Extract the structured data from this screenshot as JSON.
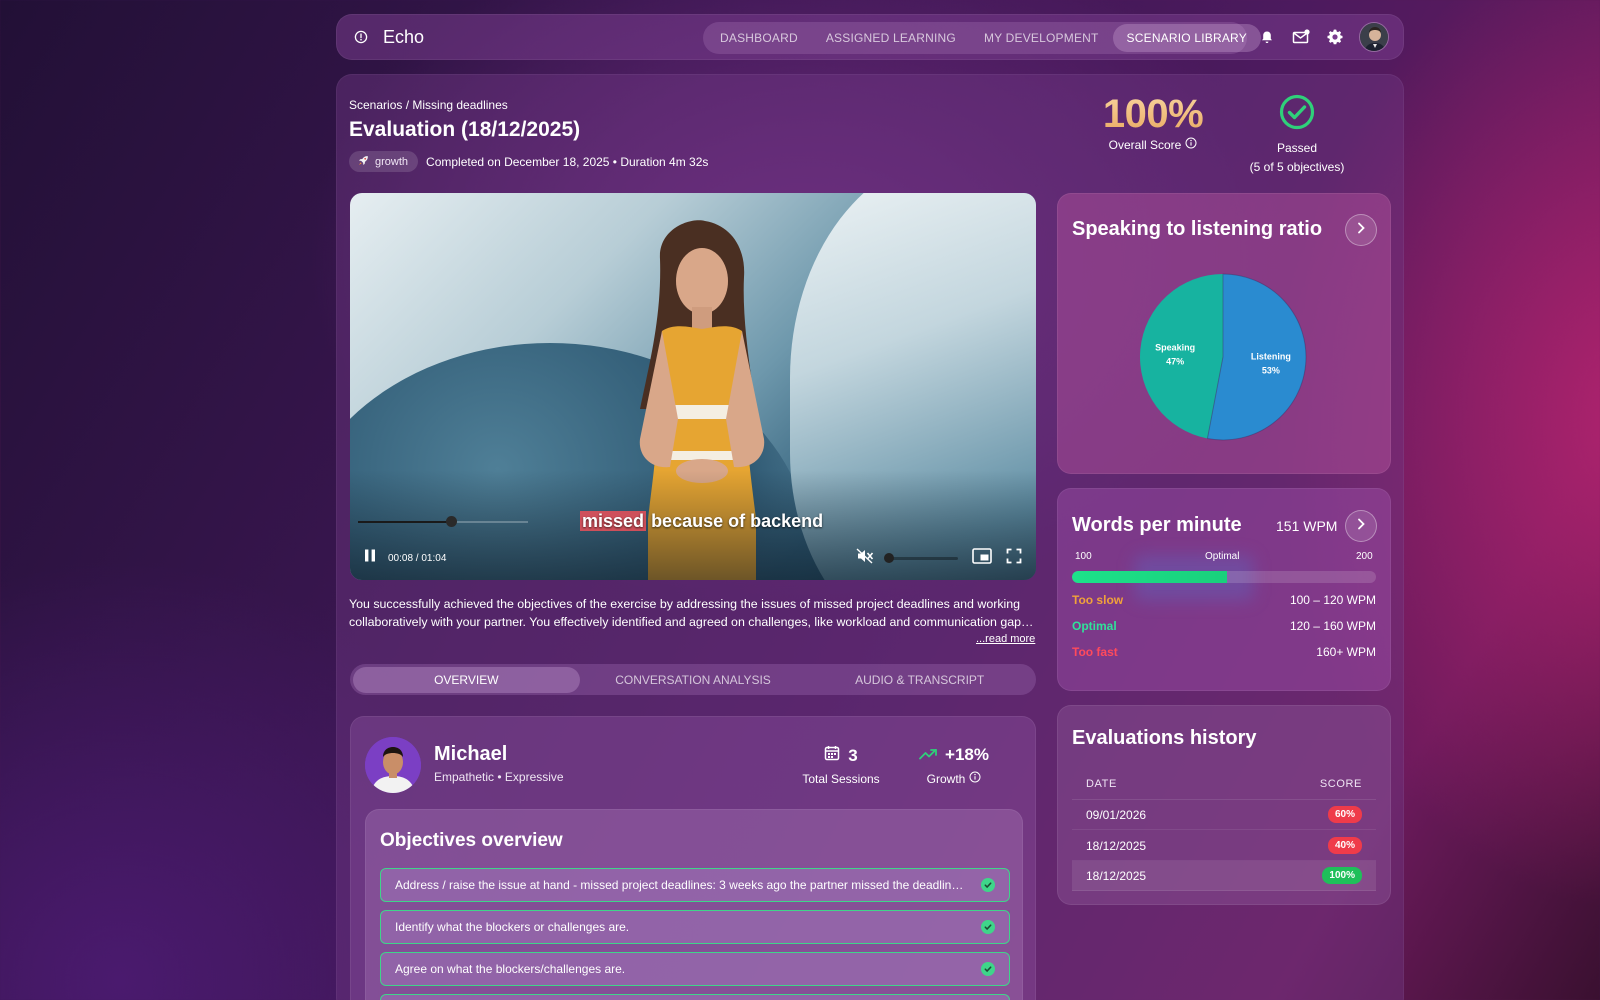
{
  "app": {
    "name": "Echo"
  },
  "nav": {
    "tabs": [
      {
        "label": "DASHBOARD"
      },
      {
        "label": "ASSIGNED LEARNING"
      },
      {
        "label": "MY DEVELOPMENT"
      },
      {
        "label": "SCENARIO LIBRARY",
        "active": true
      }
    ],
    "icons": [
      "bell-icon",
      "mail-icon",
      "gear-icon",
      "avatar"
    ]
  },
  "header": {
    "breadcrumb": "Scenarios / Missing deadlines",
    "title": "Evaluation (18/12/2025)",
    "tag": "growth",
    "completed": "Completed on December 18, 2025 • Duration 4m 32s"
  },
  "score": {
    "value": "100%",
    "label": "Overall Score",
    "status": "Passed",
    "objectives": "(5 of 5 objectives)"
  },
  "video": {
    "caption_highlight": "missed",
    "caption_rest": "because of backend",
    "time": "00:08 / 01:04",
    "progress": 0.135
  },
  "summary": {
    "text": "You successfully achieved the objectives of the exercise by addressing the issues of missed project deadlines and working collaboratively with your partner. You effectively identified and agreed on challenges, like workload and communication gap…",
    "read_more": "...read more"
  },
  "tabs": [
    {
      "label": "OVERVIEW",
      "active": true
    },
    {
      "label": "CONVERSATION ANALYSIS"
    },
    {
      "label": "AUDIO & TRANSCRIPT"
    }
  ],
  "persona": {
    "name": "Michael",
    "traits": "Empathetic • Expressive",
    "sessions_value": "3",
    "sessions_label": "Total Sessions",
    "growth_value": "+18%",
    "growth_label": "Growth"
  },
  "objectives": {
    "title": "Objectives overview",
    "items": [
      "Address / raise the issue at hand - missed project deadlines: 3 weeks ago the partner missed the deadline for the project deliverable",
      "Identify what the blockers or challenges are.",
      "Agree on what the blockers/challenges are."
    ]
  },
  "ratio": {
    "title": "Speaking to listening ratio",
    "speaking_label": "Speaking",
    "speaking_value": "47%",
    "listening_label": "Listening",
    "listening_value": "53%"
  },
  "wpm": {
    "title": "Words per minute",
    "value": "151 WPM",
    "scale_min": "100",
    "scale_mid": "Optimal",
    "scale_max": "200",
    "fill_fraction": 0.51,
    "rows": [
      {
        "label": "Too slow",
        "range": "100 – 120 WPM",
        "color": "#f0a23a"
      },
      {
        "label": "Optimal",
        "range": "120 – 160 WPM",
        "color": "#2fe39a"
      },
      {
        "label": "Too fast",
        "range": "160+ WPM",
        "color": "#ff4a5c"
      }
    ]
  },
  "history": {
    "title": "Evaluations history",
    "col_date": "DATE",
    "col_score": "SCORE",
    "rows": [
      {
        "date": "09/01/2026",
        "score": "60%",
        "color": "#ef3b4a"
      },
      {
        "date": "18/12/2025",
        "score": "40%",
        "color": "#ef3b4a"
      },
      {
        "date": "18/12/2025",
        "score": "100%",
        "color": "#1fbf5a",
        "selected": true
      }
    ]
  },
  "chart_data": {
    "type": "pie",
    "categories": [
      "Speaking",
      "Listening"
    ],
    "values": [
      47,
      53
    ],
    "title": "Speaking to listening ratio",
    "colors": [
      "#17b3a0",
      "#2a8bd0"
    ]
  }
}
